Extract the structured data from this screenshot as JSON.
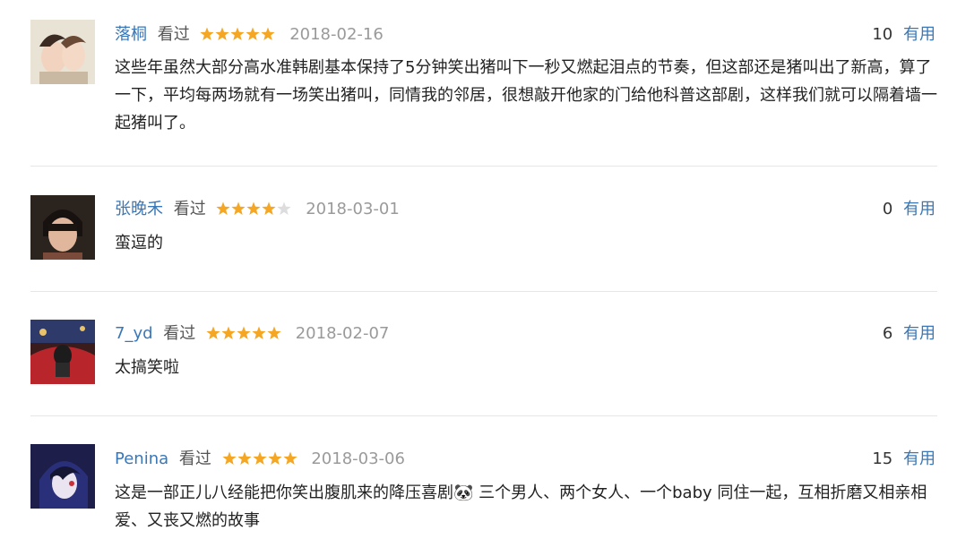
{
  "comments": [
    {
      "user": "落桐",
      "status": "看过",
      "rating": 5,
      "date": "2018-02-16",
      "useful_count": "10",
      "useful_label": "有用",
      "text": "这些年虽然大部分高水准韩剧基本保持了5分钟笑出猪叫下一秒又燃起泪点的节奏，但这部还是猪叫出了新高，算了一下，平均每两场就有一场笑出猪叫，同情我的邻居，很想敲开他家的门给他科普这部剧，这样我们就可以隔着墙一起猪叫了。"
    },
    {
      "user": "张晚禾",
      "status": "看过",
      "rating": 4,
      "date": "2018-03-01",
      "useful_count": "0",
      "useful_label": "有用",
      "text": "蛮逗的"
    },
    {
      "user": "7_yd",
      "status": "看过",
      "rating": 5,
      "date": "2018-02-07",
      "useful_count": "6",
      "useful_label": "有用",
      "text": "太搞笑啦"
    },
    {
      "user": "Penina",
      "status": "看过",
      "rating": 5,
      "date": "2018-03-06",
      "useful_count": "15",
      "useful_label": "有用",
      "text": "这是一部正儿八经能把你笑出腹肌来的降压喜剧🐼 三个男人、两个女人、一个baby 同住一起，互相折磨又相亲相爱、又丧又燃的故事"
    }
  ],
  "colors": {
    "username": "#3a77b6",
    "star_filled": "#f5a623",
    "star_empty": "#dddddd",
    "date": "#9a9a9a",
    "divider": "#e6e6e6"
  }
}
